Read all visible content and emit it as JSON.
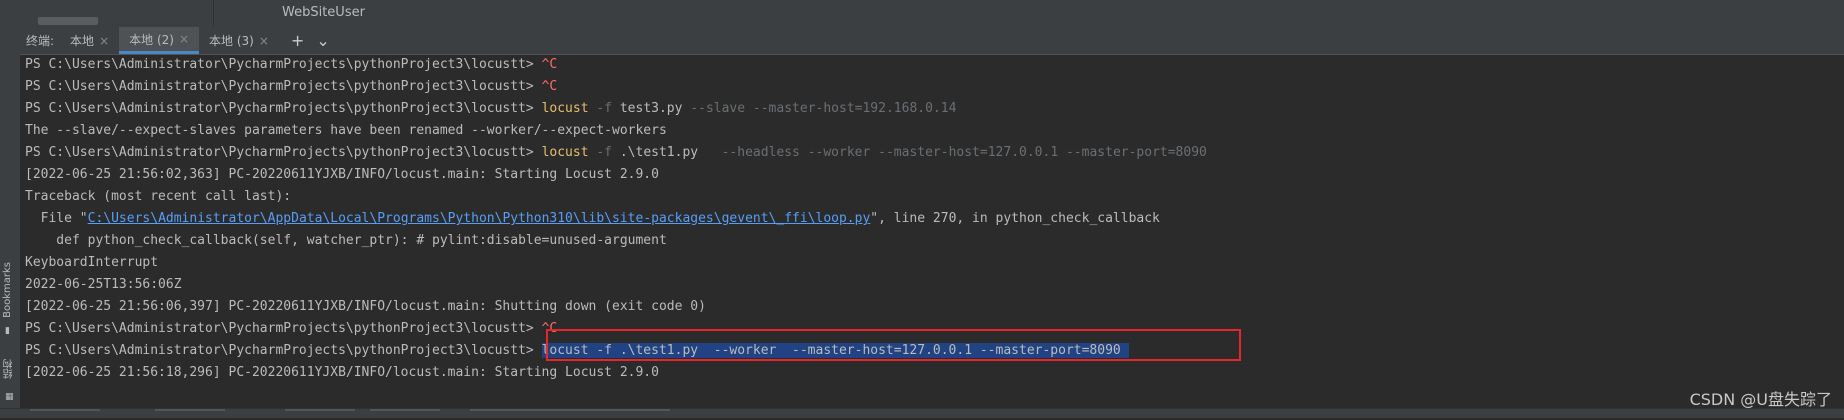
{
  "editor": {
    "filename": "WebSiteUser"
  },
  "terminal_tabs": {
    "title": "终端:",
    "tabs": [
      {
        "label": "本地",
        "active": false
      },
      {
        "label": "本地 (2)",
        "active": true
      },
      {
        "label": "本地 (3)",
        "active": false
      }
    ],
    "add_label": "+",
    "dropdown_label": "⌄"
  },
  "side": {
    "bookmarks": "Bookmarks",
    "structure": "结构"
  },
  "terminal": {
    "prompt": "PS C:\\Users\\Administrator\\PycharmProjects\\pythonProject3\\locustt> ",
    "ctrl_c": "^C",
    "line3": {
      "cmd": "locust",
      "flag": " -f ",
      "file": "test3.py",
      "args": " --slave --master-host=192.168.0.14"
    },
    "line4": "The --slave/--expect-slaves parameters have been renamed --worker/--expect-workers",
    "line5": {
      "cmd": "locust",
      "flag": " -f ",
      "file": ".\\test1.py",
      "args": "   --headless --worker --master-host=127.0.0.1 --master-port=8090"
    },
    "line6": "[2022-06-25 21:56:02,363] PC-20220611YJXB/INFO/locust.main: Starting Locust 2.9.0",
    "line7": "Traceback (most recent call last):",
    "line8": {
      "pre": "  File \"",
      "link": "C:\\Users\\Administrator\\AppData\\Local\\Programs\\Python\\Python310\\lib\\site-packages\\gevent\\_ffi\\loop.py",
      "post": "\", line 270, in python_check_callback"
    },
    "line9": "    def python_check_callback(self, watcher_ptr): # pylint:disable=unused-argument",
    "line10": "KeyboardInterrupt",
    "line11": "2022-06-25T13:56:06Z",
    "line12": "[2022-06-25 21:56:06,397] PC-20220611YJXB/INFO/locust.main: Shutting down (exit code 0)",
    "line14_selected": "locust -f .\\test1.py  --worker  --master-host=127.0.0.1 --master-port=8090 ",
    "line15": "[2022-06-25 21:56:18,296] PC-20220611YJXB/INFO/locust.main: Starting Locust 2.9.0"
  },
  "watermark": "CSDN @U盘失踪了",
  "colors": {
    "background": "#2b2b2b",
    "selection": "#214283",
    "highlight_box": "#e5262f",
    "command": "#e8bf6a"
  }
}
